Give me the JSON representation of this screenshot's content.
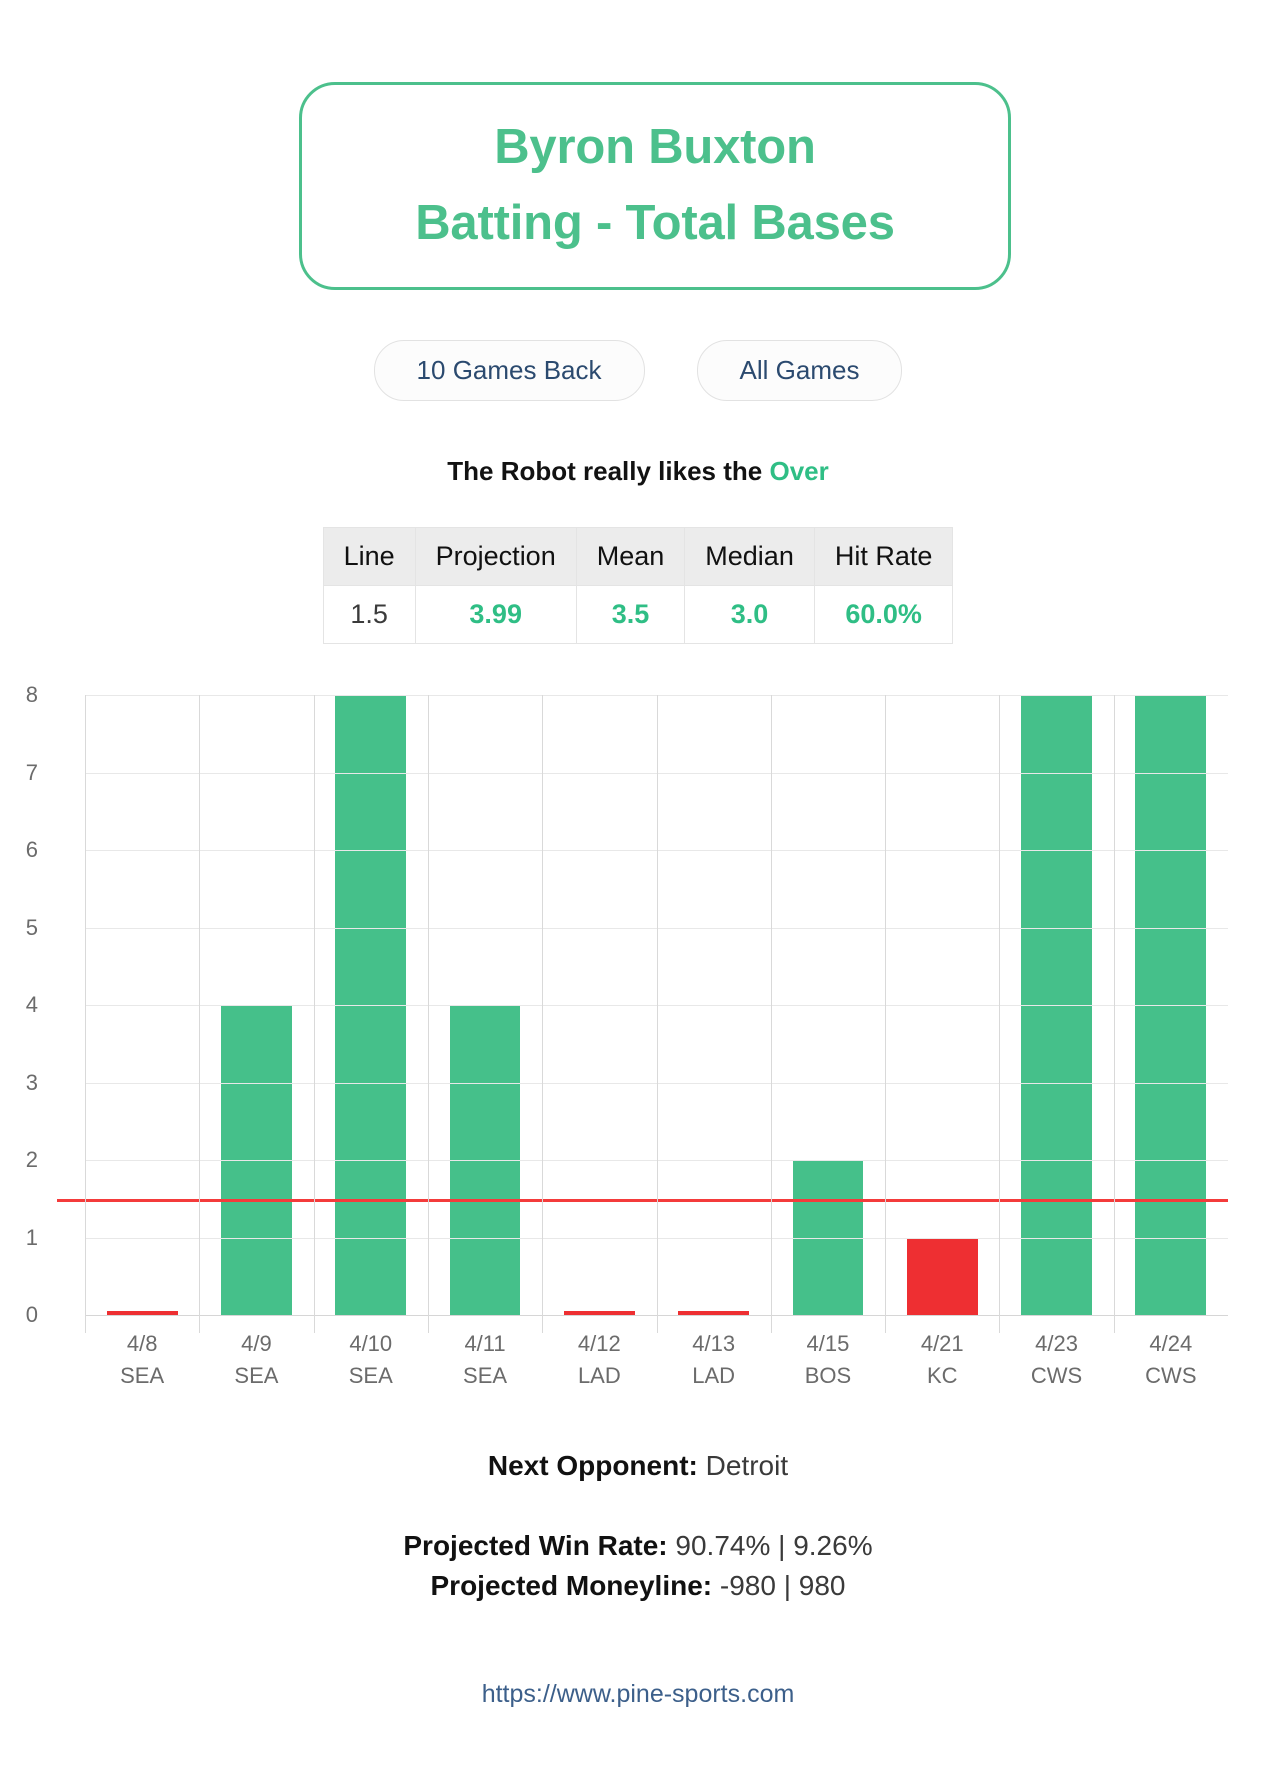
{
  "title": {
    "line1": "Byron Buxton",
    "line2": "Batting - Total Bases",
    "accent_color": "#4cc08c"
  },
  "toggles": [
    {
      "label": "10 Games Back"
    },
    {
      "label": "All Games"
    }
  ],
  "robot": {
    "prefix": "The Robot really likes the ",
    "pick": "Over",
    "pick_color": "#2fbe85"
  },
  "stats_table": {
    "headers": [
      "Line",
      "Projection",
      "Mean",
      "Median",
      "Hit Rate"
    ],
    "values": [
      "1.5",
      "3.99",
      "3.5",
      "3.0",
      "60.0%"
    ]
  },
  "footer": {
    "next_opponent_label": "Next Opponent:",
    "next_opponent_value": "Detroit",
    "win_rate_label": "Projected Win Rate:",
    "win_rate_value": "90.74% | 9.26%",
    "moneyline_label": "Projected Moneyline:",
    "moneyline_value": "-980 | 980",
    "url": "https://www.pine-sports.com"
  },
  "chart_data": {
    "type": "bar",
    "title": "Byron Buxton Batting - Total Bases",
    "xlabel": "",
    "ylabel": "",
    "ylim": [
      0,
      8
    ],
    "yticks": [
      0,
      1,
      2,
      3,
      4,
      5,
      6,
      7,
      8
    ],
    "grid": true,
    "legend": "none",
    "categories": [
      "4/8",
      "4/9",
      "4/10",
      "4/11",
      "4/12",
      "4/13",
      "4/15",
      "4/21",
      "4/23",
      "4/24"
    ],
    "opponents": [
      "SEA",
      "SEA",
      "SEA",
      "SEA",
      "LAD",
      "LAD",
      "BOS",
      "KC",
      "CWS",
      "CWS"
    ],
    "values": [
      0,
      4,
      8,
      4,
      0,
      0,
      2,
      1,
      8,
      8
    ],
    "bar_colors": [
      "#ee2f32",
      "#45c08a",
      "#45c08a",
      "#45c08a",
      "#ee2f32",
      "#ee2f32",
      "#45c08a",
      "#ee2f32",
      "#45c08a",
      "#45c08a"
    ],
    "threshold_line": {
      "value": 1.5,
      "color": "#f43b3b",
      "label": "Line 1.5"
    },
    "colors": {
      "over": "#45c08a",
      "under": "#ee2f32"
    }
  }
}
